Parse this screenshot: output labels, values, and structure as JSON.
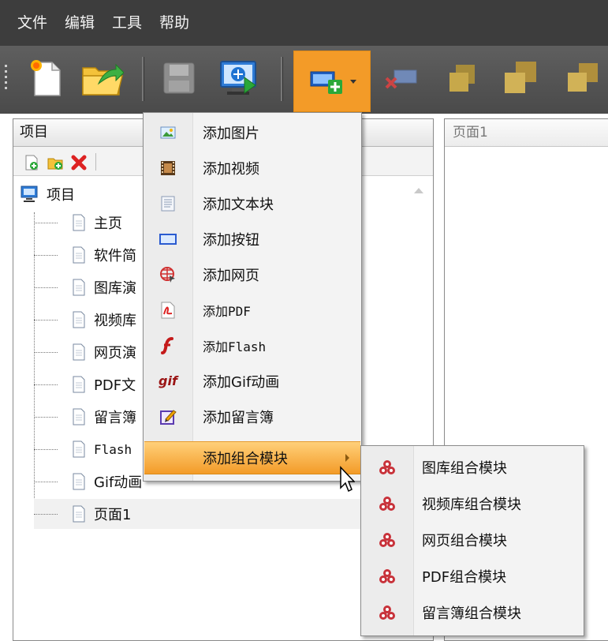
{
  "menubar": {
    "items": [
      "文件",
      "编辑",
      "工具",
      "帮助"
    ]
  },
  "project_panel": {
    "title": "项目",
    "root_label": "项目",
    "tree_items": [
      "主页",
      "软件简",
      "图库演",
      "视频库",
      "网页演",
      "PDF文",
      "留言簿",
      "Flash",
      "Gif动画",
      "页面1"
    ]
  },
  "page_panel": {
    "title": "页面1"
  },
  "context_menu": {
    "items": [
      {
        "label": "添加图片",
        "icon": "picture-icon"
      },
      {
        "label": "添加视频",
        "icon": "film-icon"
      },
      {
        "label": "添加文本块",
        "icon": "text-block-icon"
      },
      {
        "label": "添加按钮",
        "icon": "button-icon"
      },
      {
        "label": "添加网页",
        "icon": "globe-icon"
      },
      {
        "label": "添加PDF",
        "icon": "pdf-icon"
      },
      {
        "label": "添加Flash",
        "icon": "flash-icon"
      },
      {
        "label": "添加Gif动画",
        "icon": "gif-icon"
      },
      {
        "label": "添加留言簿",
        "icon": "guestbook-icon"
      },
      {
        "label": "添加组合模块",
        "icon": "",
        "highlighted": true,
        "has_submenu": true
      }
    ]
  },
  "submenu": {
    "items": [
      {
        "label": "图库组合模块",
        "icon": "module-icon"
      },
      {
        "label": "视频库组合模块",
        "icon": "module-icon"
      },
      {
        "label": "网页组合模块",
        "icon": "module-icon"
      },
      {
        "label": "PDF组合模块",
        "icon": "module-icon"
      },
      {
        "label": "留言簿组合模块",
        "icon": "module-icon"
      }
    ]
  },
  "colors": {
    "menubar_bg": "#3d3d3d",
    "toolbar_bg": "#4f4f4f",
    "highlight_top": "#ffd07a",
    "highlight_bottom": "#f39b28",
    "module_icon": "#c8323a"
  }
}
